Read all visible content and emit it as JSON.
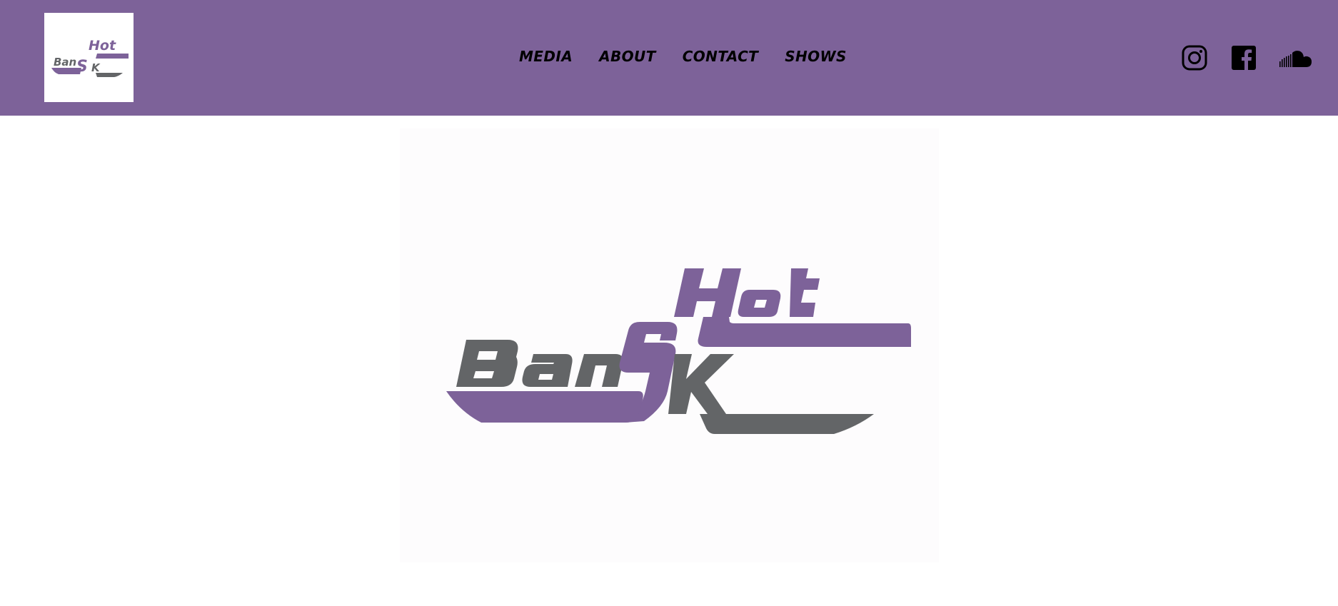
{
  "brand": {
    "logo_text_top": "Hot",
    "logo_text_left": "Ban",
    "logo_text_s": "S",
    "logo_text_k": "K",
    "colors": {
      "header_bg": "#7d6299",
      "logo_purple": "#7d6299",
      "logo_gray": "#636567"
    }
  },
  "nav": {
    "items": [
      {
        "label": "MEDIA"
      },
      {
        "label": "ABOUT"
      },
      {
        "label": "CONTACT"
      },
      {
        "label": "SHOWS"
      }
    ]
  },
  "social": {
    "icons": [
      "instagram-icon",
      "facebook-icon",
      "soundcloud-icon"
    ]
  }
}
